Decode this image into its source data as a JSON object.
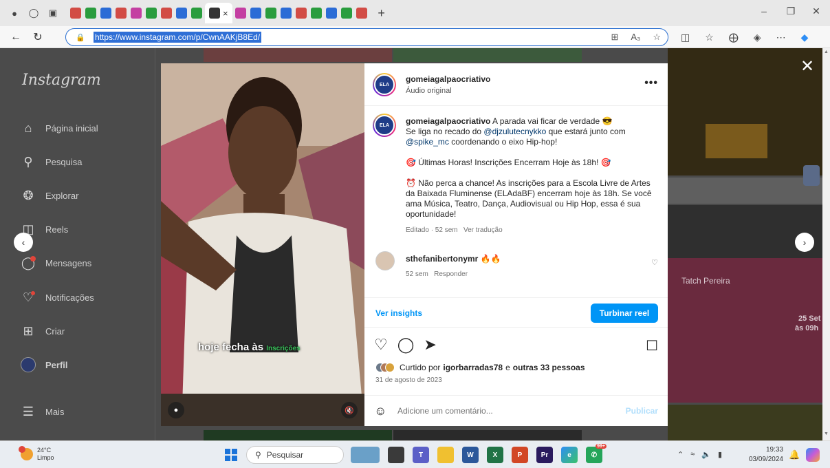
{
  "browser": {
    "url": "https://www.instagram.com/p/CwnAAKjB8Ed/",
    "colors": {
      "tab_favicons": [
        "#d24c45",
        "#2a9d3e",
        "#2b6cd6",
        "#d24c45",
        "#c43fa2",
        "#2a9d3e",
        "#d24c45",
        "#2b6cd6",
        "#2a9d3e",
        "#c43fa2",
        "#2b6cd6",
        "#2a9d3e",
        "#2b6cd6",
        "#d24c45",
        "#2a9d3e",
        "#2b6cd6",
        "#2a9d3e",
        "#d24c45"
      ]
    }
  },
  "sidebar": {
    "logo": "Instagram",
    "items": [
      {
        "label": "Página inicial",
        "icon": "home-icon"
      },
      {
        "label": "Pesquisa",
        "icon": "search-icon"
      },
      {
        "label": "Explorar",
        "icon": "compass-icon"
      },
      {
        "label": "Reels",
        "icon": "reels-icon"
      },
      {
        "label": "Mensagens",
        "icon": "messenger-icon"
      },
      {
        "label": "Notificações",
        "icon": "heart-icon"
      },
      {
        "label": "Criar",
        "icon": "plus-square-icon"
      },
      {
        "label": "Perfil",
        "icon": "avatar"
      },
      {
        "label": "Mais",
        "icon": "menu-icon"
      }
    ]
  },
  "background_tiles": {
    "labels": [
      "Tatch Pereira",
      "25 Set",
      "às 09h"
    ]
  },
  "video": {
    "caption_main": "hoje fecha às",
    "caption_green": "Inscrições"
  },
  "post": {
    "username": "gomeiagalpaocriativo",
    "audio": "Áudio original",
    "caption_username": "gomeiagalpaocriativo",
    "caption_line1": " A parada vai ficar de verdade 😎",
    "caption_line2_pre": "Se liga no recado do ",
    "mention1": "@djzulutecnykko",
    "caption_line2_mid": " que estará junto com ",
    "mention2": "@spike_mc",
    "caption_line2_post": " coordenando o eixo Hip-hop!",
    "paragraph2": "🎯 Últimas Horas! Inscrições Encerram Hoje às 18h! 🎯",
    "paragraph3": "⏰ Não perca a chance! As inscrições para a Escola Livre de Artes da Baixada Fluminense (ELAdaBF) encerram hoje às 18h. Se você ama Música, Teatro, Dança, Audiovisual ou Hip Hop, essa é sua oportunidade!",
    "edited": "Editado · 52 sem",
    "see_translation": "Ver tradução",
    "comment": {
      "username": "sthefanibertonymr",
      "text": " 🔥🔥",
      "time": "52 sem",
      "reply": "Responder"
    },
    "insights": "Ver insights",
    "boost": "Turbinar reel",
    "likes_prefix": "Curtido por ",
    "likes_user": "igorbarradas78",
    "likes_mid": " e ",
    "likes_others": "outras 33 pessoas",
    "date": "31 de agosto de 2023",
    "comment_placeholder": "Adicione um comentário...",
    "post_button": "Publicar"
  },
  "taskbar": {
    "temperature": "24°C",
    "weather": "Limpo",
    "search_placeholder": "Pesquisar",
    "badge": "99+",
    "time": "19:33",
    "date": "03/09/2024"
  }
}
